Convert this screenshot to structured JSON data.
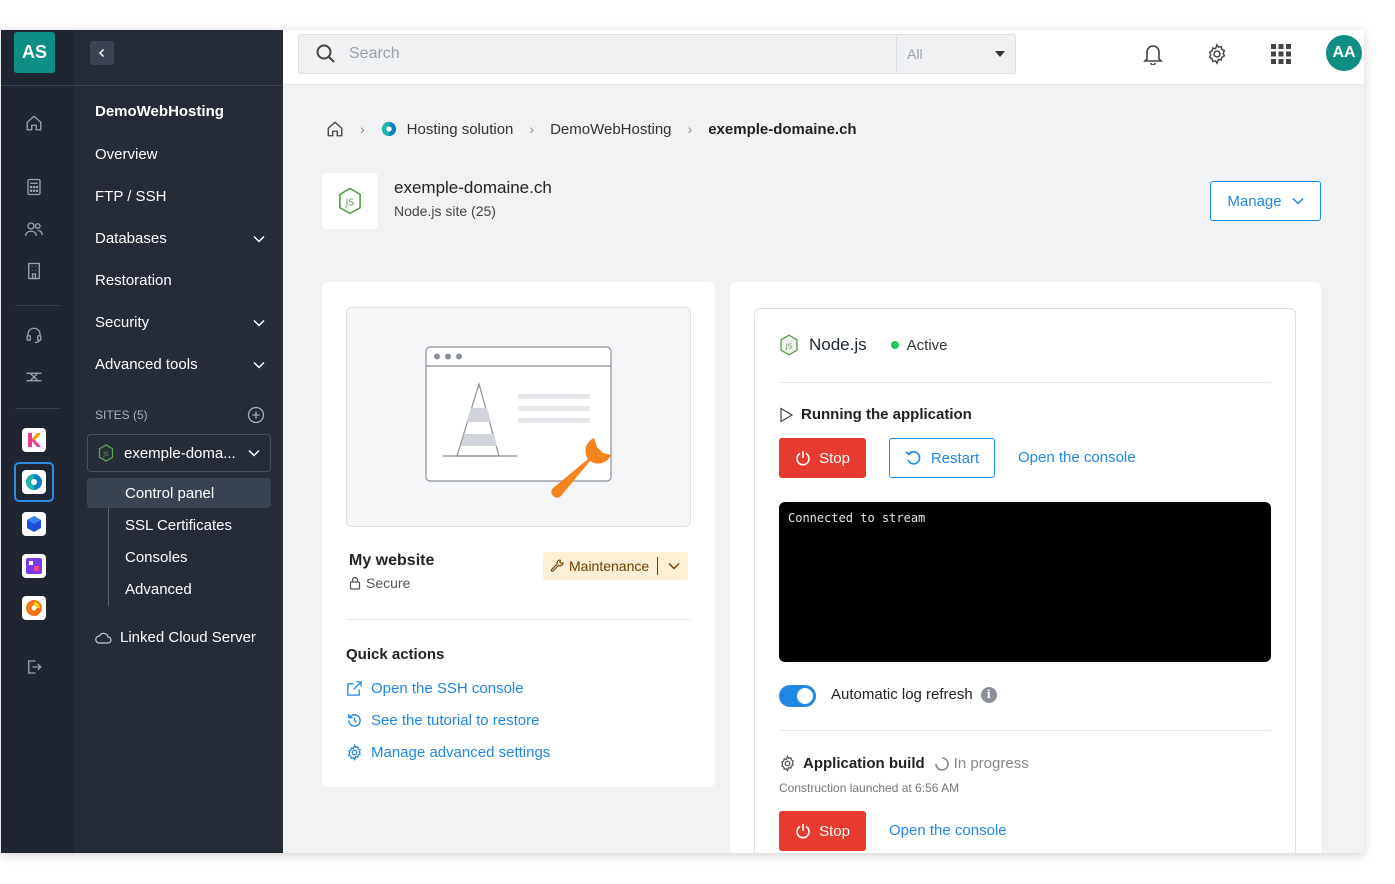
{
  "rail": {
    "logo": "AS",
    "icons": [
      "home-icon",
      "calculator-icon",
      "users-icon",
      "building-icon",
      "headset-icon",
      "diagram-icon"
    ],
    "apps": [
      "kchat-app",
      "hosting-app",
      "cube-app",
      "kmeet-app",
      "kdrive-app"
    ],
    "logout_icon": "logout-icon"
  },
  "sidebar": {
    "title": "DemoWebHosting",
    "items": [
      {
        "label": "Overview",
        "expandable": false
      },
      {
        "label": "FTP / SSH",
        "expandable": false
      },
      {
        "label": "Databases",
        "expandable": true
      },
      {
        "label": "Restoration",
        "expandable": false
      },
      {
        "label": "Security",
        "expandable": true
      },
      {
        "label": "Advanced tools",
        "expandable": true
      }
    ],
    "sites_label": "SITES (5)",
    "site_selected": "exemple-doma...",
    "site_sub": [
      "Control panel",
      "SSL Certificates",
      "Consoles",
      "Advanced"
    ],
    "site_sub_active": "Control panel",
    "linked": "Linked Cloud Server"
  },
  "topbar": {
    "search_placeholder": "Search",
    "filter_value": "All",
    "avatar": "AA"
  },
  "breadcrumb": {
    "items": [
      "Hosting solution",
      "DemoWebHosting"
    ],
    "current": "exemple-domaine.ch"
  },
  "site": {
    "name": "exemple-domaine.ch",
    "type": "Node.js site (25)",
    "manage_label": "Manage"
  },
  "website_card": {
    "title": "My website",
    "secure_label": "Secure",
    "maintenance_label": "Maintenance",
    "quick_actions_title": "Quick actions",
    "quick_actions": [
      {
        "label": "Open the SSH console",
        "icon": "external-link-icon"
      },
      {
        "label": "See the tutorial to restore",
        "icon": "history-icon"
      },
      {
        "label": "Manage advanced settings",
        "icon": "gear-icon"
      }
    ]
  },
  "node_card": {
    "title": "Node.js",
    "status": "Active",
    "status_color": "#22c55e",
    "running_title": "Running the application",
    "stop_label": "Stop",
    "restart_label": "Restart",
    "open_console_label": "Open the console",
    "console_output": "Connected to stream",
    "auto_refresh_label": "Automatic log refresh",
    "auto_refresh_on": true,
    "build_title": "Application build",
    "build_status": "In progress",
    "build_sub": "Construction launched at 6:56 AM",
    "build_stop_label": "Stop",
    "build_console_label": "Open the console"
  },
  "colors": {
    "accent": "#1e88e5",
    "danger": "#e83b2f",
    "brand": "#0f8f83",
    "sidebar": "#252c38",
    "rail": "#1f2632"
  }
}
